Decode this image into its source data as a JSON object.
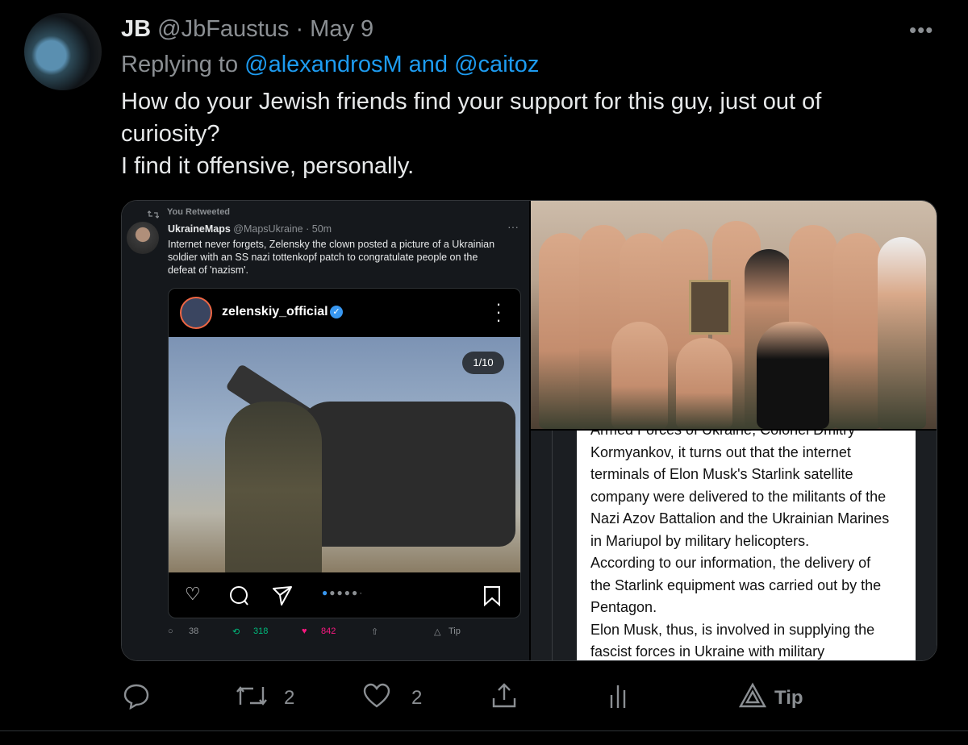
{
  "tweet": {
    "name": "JB",
    "handle": "@JbFaustus",
    "sep": "·",
    "date": "May 9",
    "replying_prefix": "Replying to ",
    "replying_to": "@alexandrosM and @caitoz",
    "text_lines": [
      "How do your Jewish friends find your support for this guy, just out of curiosity?",
      "I find it offensive, personally."
    ],
    "more": "•••"
  },
  "embedded_tweet": {
    "retweet_label": "You Retweeted",
    "name": "UkraineMaps",
    "handle": "@MapsUkraine",
    "time": "· 50m",
    "more": "···",
    "text": "Internet never forgets, Zelensky the clown posted a picture of a Ukrainian soldier with an SS nazi tottenkopf patch to congratulate people on the defeat of 'nazism'.",
    "instagram": {
      "username": "zelenskiy_official",
      "verified": "✓",
      "counter": "1/10"
    },
    "stats": {
      "replies": "38",
      "retweets": "318",
      "likes": "842",
      "tip": "Tip"
    }
  },
  "doc_text": [
    "Armed Forces of Ukraine, Colonel Dmitry",
    "Kormyankov, it turns out that the internet",
    "terminals of Elon Musk's Starlink satellite",
    "company were delivered to the militants of the",
    "Nazi Azov Battalion and the Ukrainian Marines",
    "in Mariupol by military helicopters.",
    "According to our information, the delivery of",
    "the Starlink equipment was carried out by the",
    "Pentagon.",
    "Elon Musk, thus, is involved in supplying the",
    "fascist forces in Ukraine with military"
  ],
  "actions": {
    "replies": "",
    "retweets": "2",
    "likes": "2",
    "tip": "Tip"
  },
  "colors": {
    "accent": "#1d9bf0",
    "background": "#000000",
    "muted": "#8b8f93",
    "retweet_green": "#00ba7c",
    "like_pink": "#f91880"
  }
}
